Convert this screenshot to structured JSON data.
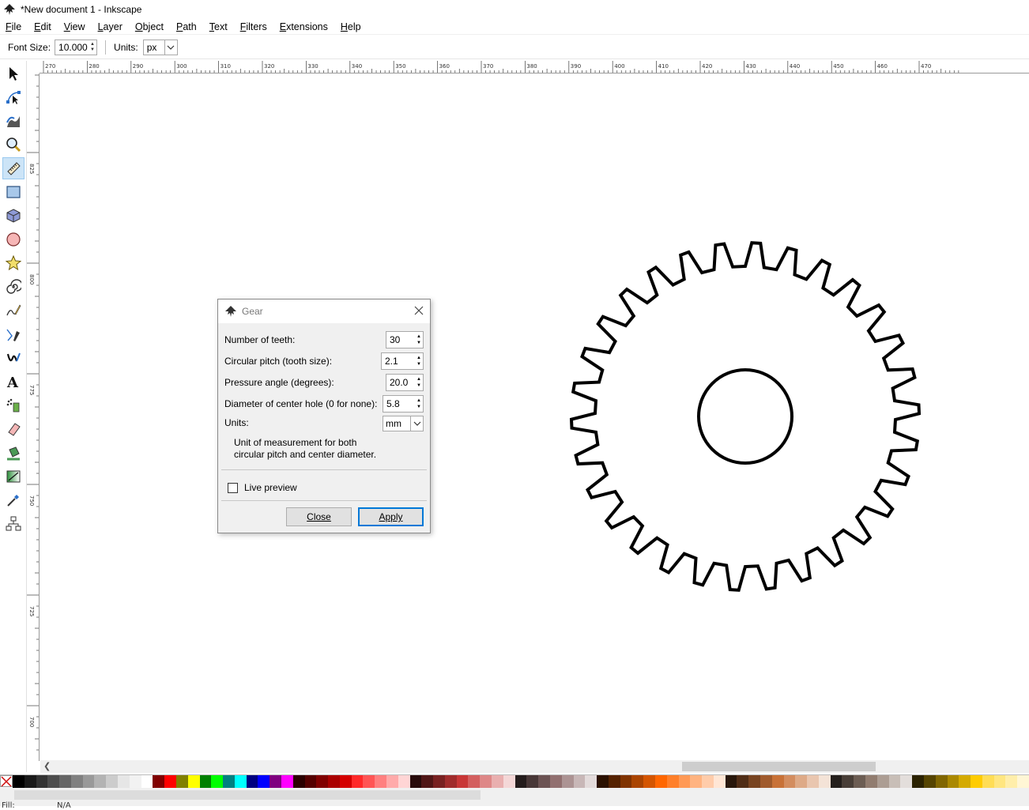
{
  "window": {
    "title": "*New document 1 - Inkscape"
  },
  "menu": [
    "File",
    "Edit",
    "View",
    "Layer",
    "Object",
    "Path",
    "Text",
    "Filters",
    "Extensions",
    "Help"
  ],
  "toolctrl": {
    "font_size_label": "Font Size:",
    "font_size_value": "10.000",
    "units_label": "Units:",
    "units_value": "px"
  },
  "tools": [
    "selector-icon",
    "node-editor-icon",
    "tweak-icon",
    "zoom-icon",
    "measure-icon",
    "rectangle-icon",
    "3d-box-icon",
    "ellipse-icon",
    "star-icon",
    "spiral-icon",
    "pencil-icon",
    "pen-icon",
    "calligraphy-icon",
    "text-icon",
    "spray-icon",
    "eraser-icon",
    "paint-bucket-icon",
    "gradient-icon",
    "dropper-icon",
    "connector-icon"
  ],
  "ruler": {
    "h_labels": [
      "270",
      "280",
      "290",
      "300",
      "310",
      "320",
      "330",
      "340",
      "350",
      "360",
      "370",
      "380",
      "390",
      "400",
      "410",
      "420",
      "430",
      "440",
      "450",
      "460",
      "470"
    ],
    "v_labels": [
      "825",
      "800",
      "775",
      "750",
      "725",
      "700"
    ]
  },
  "gear": {
    "teeth": 30,
    "hole_ratio": 0.27
  },
  "dialog": {
    "title": "Gear",
    "teeth_label": "Number of teeth:",
    "teeth_value": "30",
    "pitch_label": "Circular pitch (tooth size):",
    "pitch_value": "2.1",
    "angle_label": "Pressure angle (degrees):",
    "angle_value": "20.0",
    "hole_label": "Diameter of center hole (0 for none):",
    "hole_value": "5.8",
    "units_label": "Units:",
    "units_value": "mm",
    "desc_line1": "Unit of measurement for both",
    "desc_line2": "circular pitch and center diameter.",
    "live_preview_label": "Live preview",
    "close_label": "Close",
    "apply_label": "Apply"
  },
  "status": {
    "fill_label": "Fill:",
    "fill_value": "N/A"
  },
  "palette": [
    "#000000",
    "#1a1a1a",
    "#333333",
    "#4d4d4d",
    "#666666",
    "#808080",
    "#999999",
    "#b3b3b3",
    "#cccccc",
    "#e6e6e6",
    "#f2f2f2",
    "#ffffff",
    "#800000",
    "#ff0000",
    "#808000",
    "#ffff00",
    "#008000",
    "#00ff00",
    "#008080",
    "#00ffff",
    "#000080",
    "#0000ff",
    "#800080",
    "#ff00ff",
    "#2b0000",
    "#550000",
    "#800000",
    "#aa0000",
    "#d40000",
    "#ff2a2a",
    "#ff5555",
    "#ff8080",
    "#ffaaaa",
    "#ffd5d5",
    "#280b0b",
    "#501616",
    "#782121",
    "#a02c2c",
    "#c83737",
    "#d35f5f",
    "#de8787",
    "#e9afaf",
    "#f4d7d7",
    "#241c1c",
    "#483737",
    "#6c5353",
    "#916f6f",
    "#ac9393",
    "#c8b7b7",
    "#e3dbdb",
    "#2b1100",
    "#552200",
    "#803300",
    "#aa4400",
    "#d45500",
    "#ff6600",
    "#ff7f2a",
    "#ff9955",
    "#ffb380",
    "#ffccaa",
    "#ffe6d5",
    "#28170b",
    "#502d16",
    "#784421",
    "#a05a2c",
    "#c87137",
    "#d38d5f",
    "#deaa87",
    "#e9c6af",
    "#f4e3d7",
    "#241f1c",
    "#483e37",
    "#6c5d53",
    "#917c6f",
    "#ac9d93",
    "#c8beb7",
    "#e3dedb",
    "#2b2200",
    "#554400",
    "#806600",
    "#aa8800",
    "#d4aa00",
    "#ffcc00",
    "#ffdd55",
    "#ffe680",
    "#ffeeaa",
    "#fff6d5"
  ]
}
